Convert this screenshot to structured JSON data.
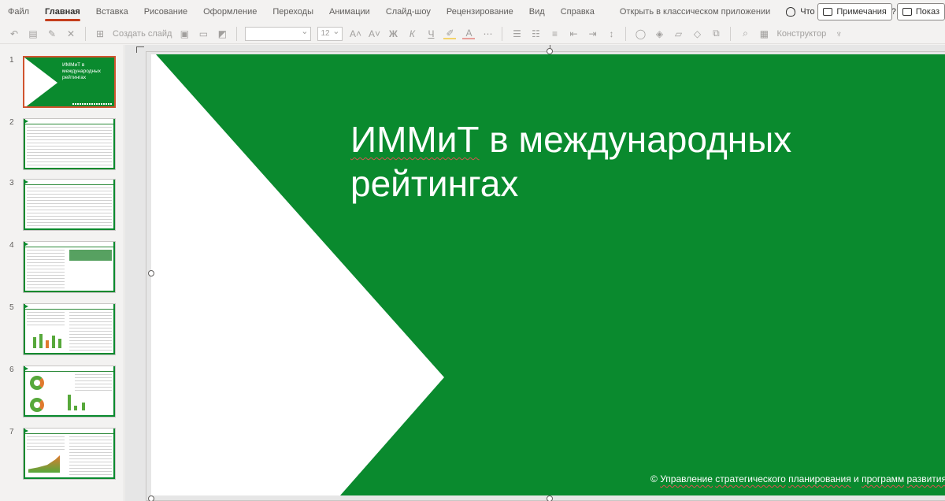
{
  "ribbon": {
    "tabs": [
      "Файл",
      "Главная",
      "Вставка",
      "Рисование",
      "Оформление",
      "Переходы",
      "Анимации",
      "Слайд-шоу",
      "Рецензирование",
      "Вид",
      "Справка"
    ],
    "active_tab": "Главная",
    "open_desktop": "Открыть в классическом приложении",
    "tell_me": "Что вы хотите сделать?",
    "comments_btn": "Примечания",
    "present_btn": "Показ"
  },
  "toolbar": {
    "new_slide": "Создать слайд",
    "font_size": "12",
    "designer": "Конструктор"
  },
  "thumbnails": {
    "numbers": [
      "1",
      "2",
      "3",
      "4",
      "5",
      "6",
      "7"
    ],
    "slide1_title": "ИММиТ в международных рейтингах",
    "selected": 1
  },
  "slide": {
    "title_word1": "ИММиТ",
    "title_rest": " в международных рейтингах",
    "footer_prefix": "© ",
    "footer_words": [
      "Управление",
      "стратегического",
      "планирования",
      "и",
      "программ",
      "развития"
    ]
  },
  "colors": {
    "slide_green": "#0a8a2e",
    "accent_orange": "#c43e1c",
    "selection_border": "#d0542f"
  }
}
